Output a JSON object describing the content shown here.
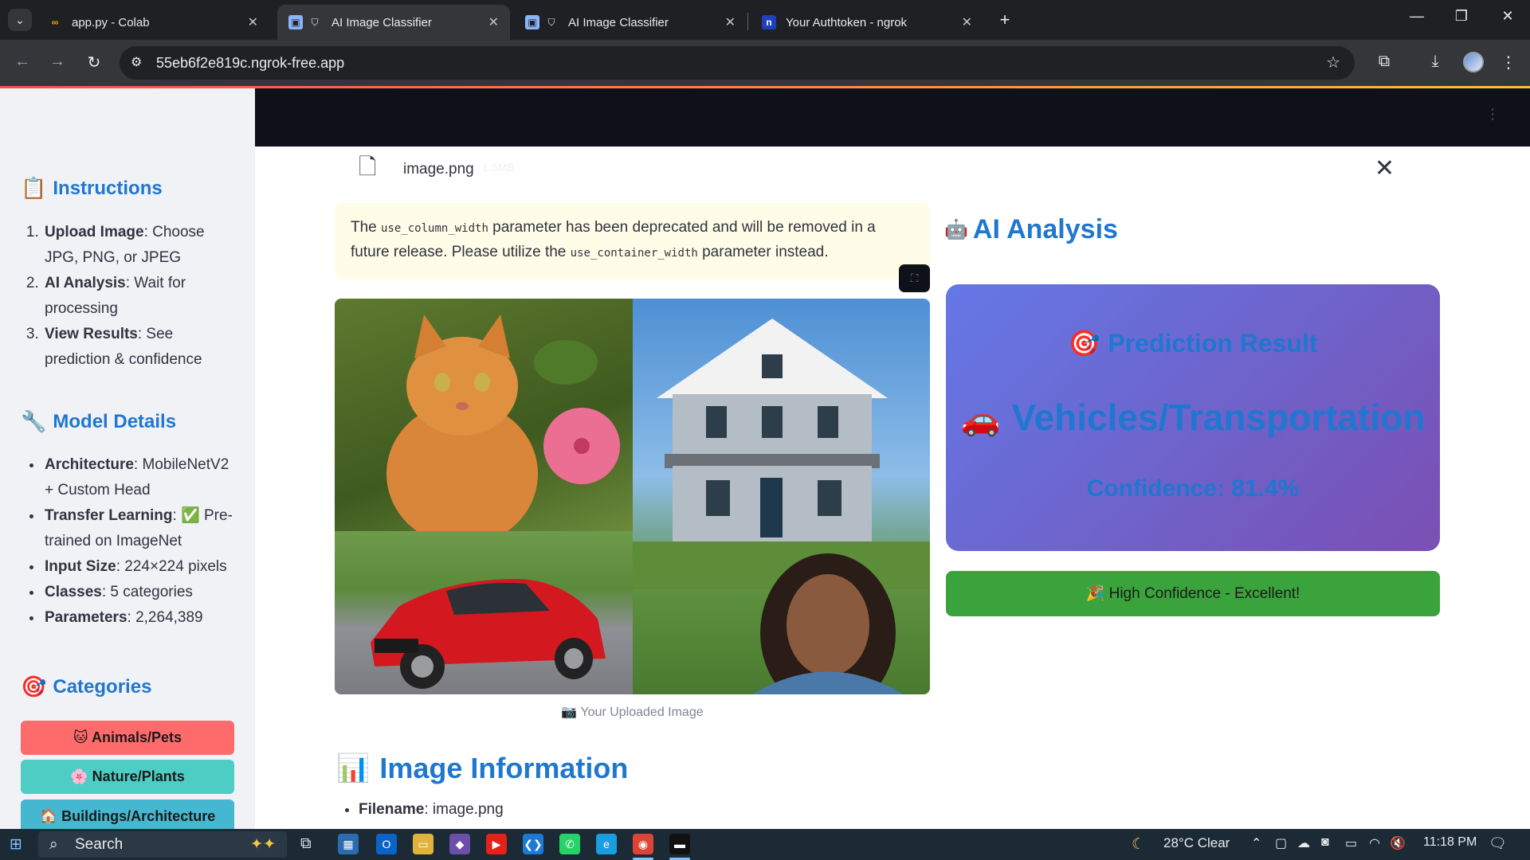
{
  "browser": {
    "tabs": [
      {
        "title": "app.py - Colab",
        "favicon": "colab-icon"
      },
      {
        "title": "AI Image Classifier",
        "favicon": "streamlit-icon"
      },
      {
        "title": "AI Image Classifier",
        "favicon": "streamlit-icon"
      },
      {
        "title": "Your Authtoken - ngrok",
        "favicon": "ngrok-icon"
      }
    ],
    "active_tab": 1,
    "url": "55eb6f2e819c.ngrok-free.app"
  },
  "sidebar": {
    "instructions_title": "Instructions",
    "instructions": [
      {
        "bold": "Upload Image",
        "text": ": Choose JPG, PNG, or JPEG"
      },
      {
        "bold": "AI Analysis",
        "text": ": Wait for processing"
      },
      {
        "bold": "View Results",
        "text": ": See prediction & confidence"
      }
    ],
    "model_title": "Model Details",
    "model_details": [
      {
        "bold": "Architecture",
        "text": ": MobileNetV2 + Custom Head"
      },
      {
        "bold": "Transfer Learning",
        "text": ": ✅ Pre-trained on ImageNet"
      },
      {
        "bold": "Input Size",
        "text": ": 224×224 pixels"
      },
      {
        "bold": "Classes",
        "text": ": 5 categories"
      },
      {
        "bold": "Parameters",
        "text": ": 2,264,389"
      }
    ],
    "categories_title": "Categories",
    "categories": [
      {
        "label": "🐱 Animals/Pets",
        "color": "#ff6b6b"
      },
      {
        "label": "🌸 Nature/Plants",
        "color": "#4ecdc4"
      },
      {
        "label": "🏠 Buildings/Architecture",
        "color": "#45b7d1"
      }
    ]
  },
  "main": {
    "file": {
      "name": "image.png",
      "size": "1.5MB"
    },
    "warning": {
      "p1": "The ",
      "code1": "use_column_width",
      "p2": " parameter has been deprecated and will be removed in a future release. Please utilize the ",
      "code2": "use_container_width",
      "p3": " parameter instead."
    },
    "caption": "📷 Your Uploaded Image",
    "image_info_title": "Image Information",
    "image_info": [
      {
        "bold": "Filename",
        "text": ": image.png"
      }
    ],
    "ai_title": "AI Analysis",
    "prediction": {
      "title": "Prediction Result",
      "class": "Vehicles/Transportation",
      "confidence": "Confidence: 81.4%"
    },
    "success_msg": "🎉 High Confidence - Excellent!"
  },
  "taskbar": {
    "search_placeholder": "Search",
    "weather": "28°C  Clear",
    "time": "11:18 PM"
  },
  "colors": {
    "accent": "#1f77d0",
    "card_gradient_start": "#6478e6",
    "card_gradient_end": "#7b4fb3",
    "success": "#3ba33b",
    "warning_bg": "#fffce7"
  }
}
